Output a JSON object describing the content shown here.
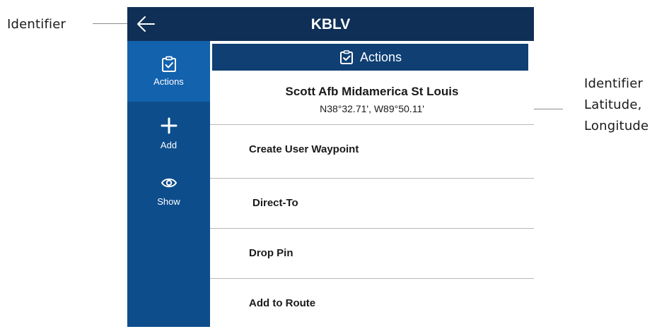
{
  "annotations": {
    "left": "Identifier",
    "right_lines": [
      "Identifier",
      "Latitude,",
      "Longitude"
    ]
  },
  "topbar": {
    "title": "KBLV",
    "back_icon": "arrow-left-icon"
  },
  "sidebar": {
    "items": [
      {
        "label": "Actions",
        "icon": "clipboard-check-icon",
        "active": true
      },
      {
        "label": "Add",
        "icon": "plus-icon",
        "active": false
      },
      {
        "label": "Show",
        "icon": "eye-icon",
        "active": false
      }
    ]
  },
  "panel": {
    "header_label": "Actions",
    "airport_name": "Scott Afb Midamerica St Louis",
    "coordinates": "N38°32.71', W89°50.11'",
    "actions": [
      {
        "label": "Create User Waypoint"
      },
      {
        "label": "Direct-To"
      },
      {
        "label": "Drop Pin"
      },
      {
        "label": "Add to Route"
      }
    ]
  },
  "colors": {
    "topbar": "#0f2f57",
    "sidebar": "#0d4d8c",
    "sidebar_active": "#1262ad",
    "header": "#0f3f73"
  }
}
